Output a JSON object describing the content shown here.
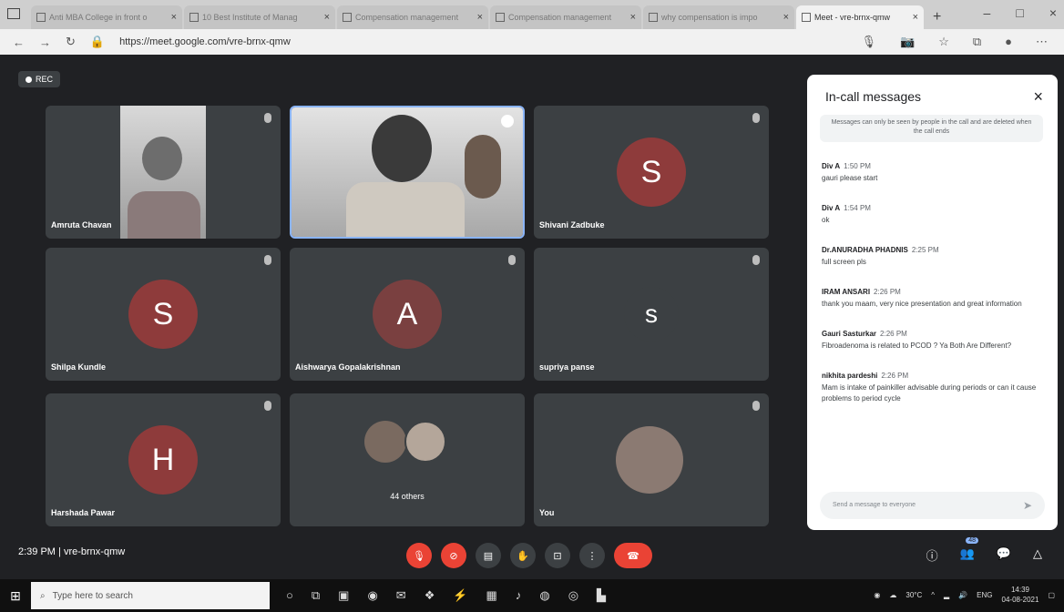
{
  "browser": {
    "tabs": [
      {
        "title": "Anti MBA College in front o"
      },
      {
        "title": "10 Best Institute of Manag"
      },
      {
        "title": "Compensation management"
      },
      {
        "title": "Compensation management"
      },
      {
        "title": "why compensation is impo"
      },
      {
        "title": "Meet - vre-brnx-qmw",
        "active": true
      }
    ],
    "url": "https://meet.google.com/vre-brnx-qmw"
  },
  "meet": {
    "rec_label": "REC",
    "tiles": [
      {
        "name": "Amruta Chavan",
        "type": "video"
      },
      {
        "name": "",
        "type": "video"
      },
      {
        "name": "Shivani Zadbuke",
        "initial": "S"
      },
      {
        "name": "Shilpa Kundle",
        "initial": "S"
      },
      {
        "name": "Aishwarya Gopalakrishnan",
        "initial": "A"
      },
      {
        "name": "supriya panse",
        "initial": "s"
      },
      {
        "name": "Harshada Pawar",
        "initial": "H"
      },
      {
        "name": "44 others",
        "type": "others"
      },
      {
        "name": "You",
        "type": "self"
      }
    ],
    "time": "2:39 PM",
    "meeting_code": "vre-brnx-qmw",
    "participants_badge": "48"
  },
  "chat": {
    "title": "In-call messages",
    "notice": "Messages can only be seen by people in the call and are deleted when the call ends",
    "messages": [
      {
        "sender": "Div A",
        "time": "1:50 PM",
        "text": "gauri please start"
      },
      {
        "sender": "Div A",
        "time": "1:54 PM",
        "text": "ok"
      },
      {
        "sender": "Dr.ANURADHA PHADNIS",
        "time": "2:25 PM",
        "text": "full screen pls"
      },
      {
        "sender": "IRAM ANSARI",
        "time": "2:26 PM",
        "text": "thank you maam, very nice presentation and great information"
      },
      {
        "sender": "Gauri Sasturkar",
        "time": "2:26 PM",
        "text": "Fibroadenoma is related to PCOD ? Ya Both Are Different?"
      },
      {
        "sender": "nikhita pardeshi",
        "time": "2:26 PM",
        "text": "Mam is intake of painkiller advisable during periods or can it cause problems to period cycle"
      }
    ],
    "compose_placeholder": "Send a message to everyone"
  },
  "taskbar": {
    "search_placeholder": "Type here to search",
    "temperature": "30°C",
    "language": "ENG",
    "clock_time": "14:39",
    "clock_date": "04-08-2021"
  }
}
